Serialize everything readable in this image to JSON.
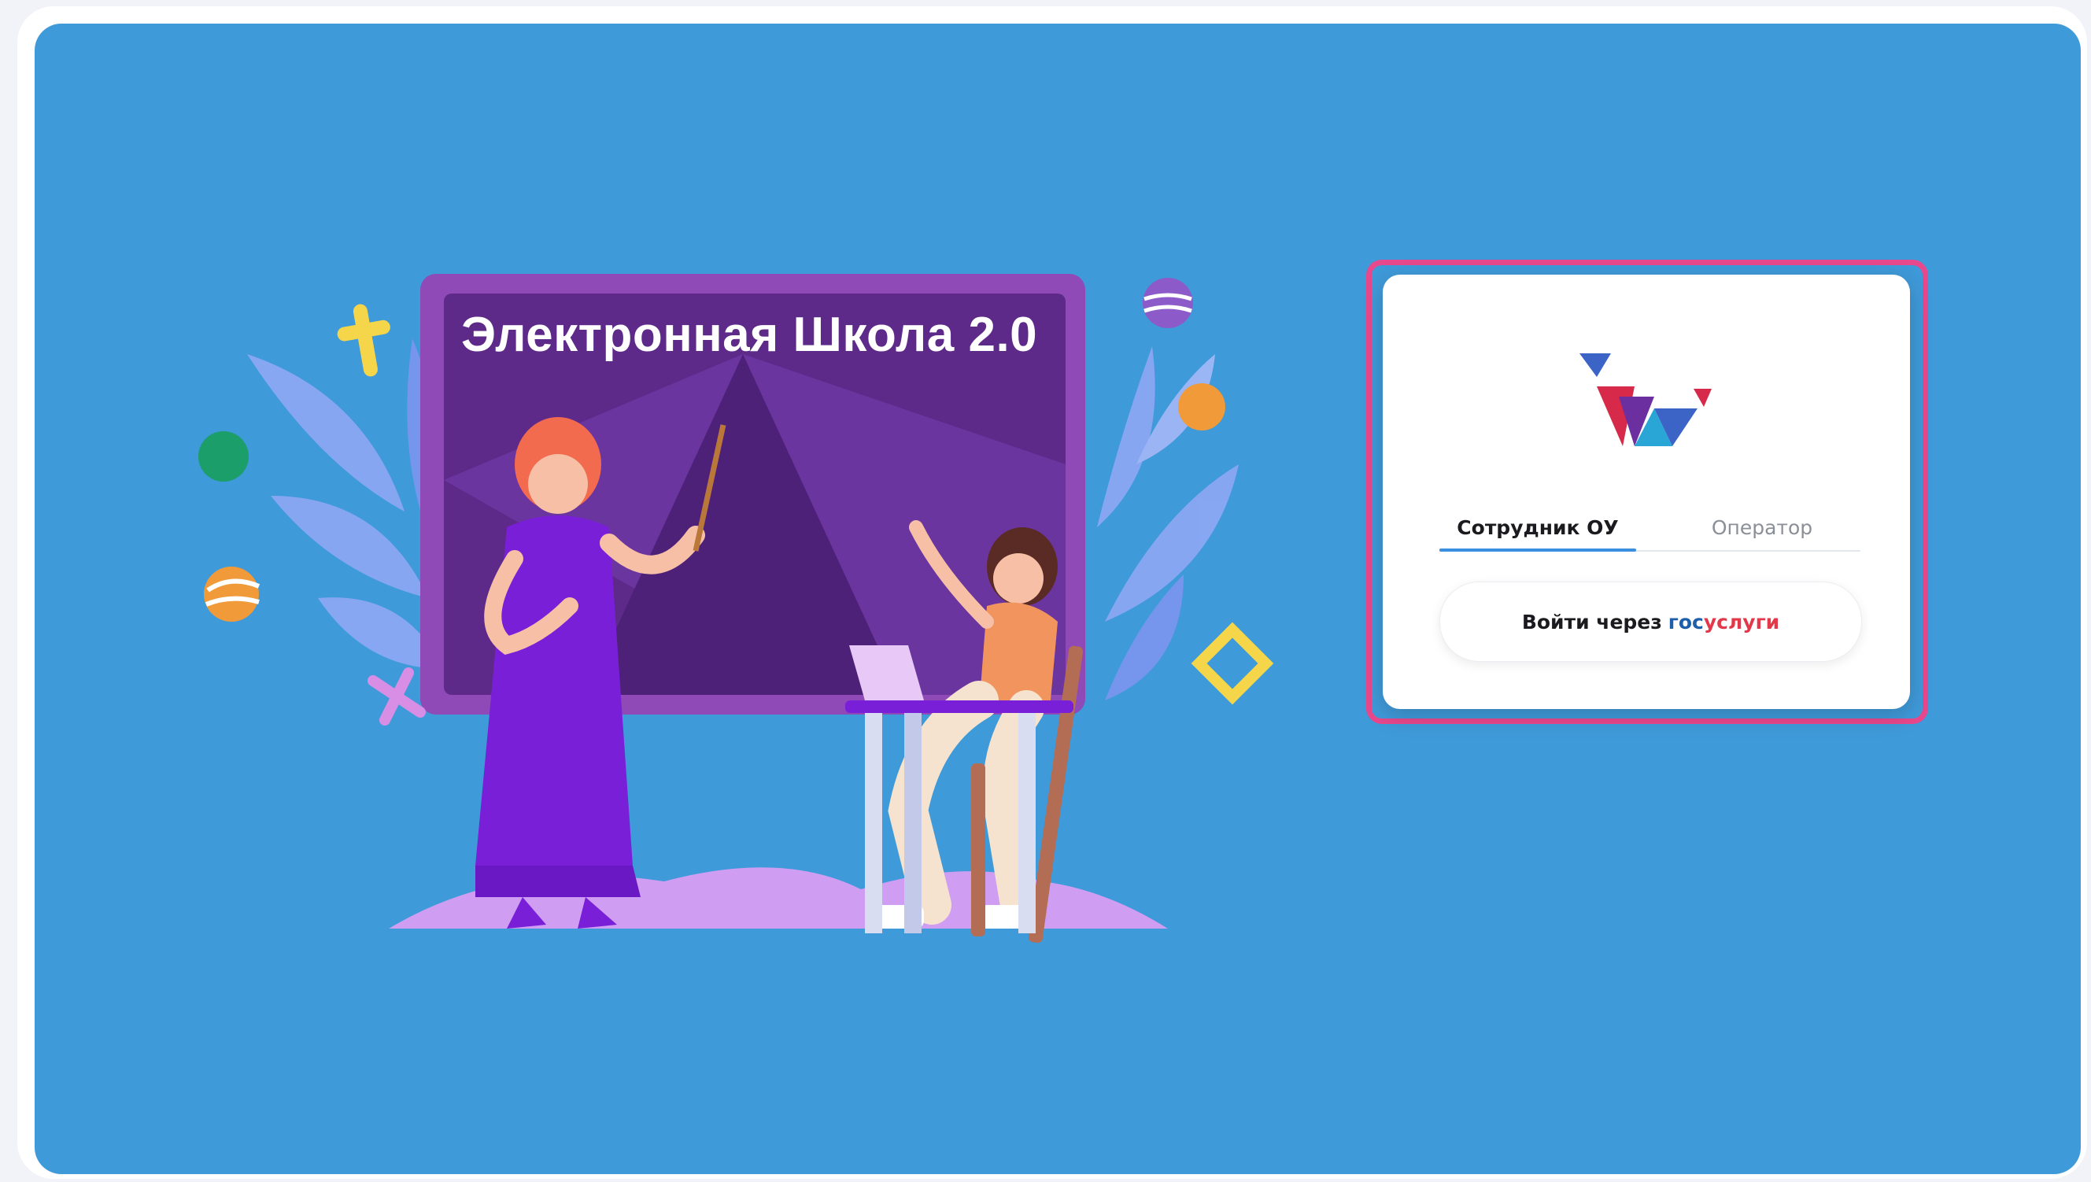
{
  "board": {
    "title": "Электронная Школа 2.0"
  },
  "login": {
    "tabs": [
      {
        "label": "Сотрудник ОУ",
        "active": true
      },
      {
        "label": "Оператор",
        "active": false
      }
    ],
    "gos_button": {
      "prefix": "Войти через",
      "brand_part1": "гос",
      "brand_part2": "услуги"
    }
  },
  "colors": {
    "background": "#3f9ad9",
    "highlight": "#e8488c",
    "board": "#6a2c9a",
    "tab_underline": "#3a8fe0",
    "gos_blue": "#1f5ea8",
    "gos_red": "#e3384a"
  }
}
